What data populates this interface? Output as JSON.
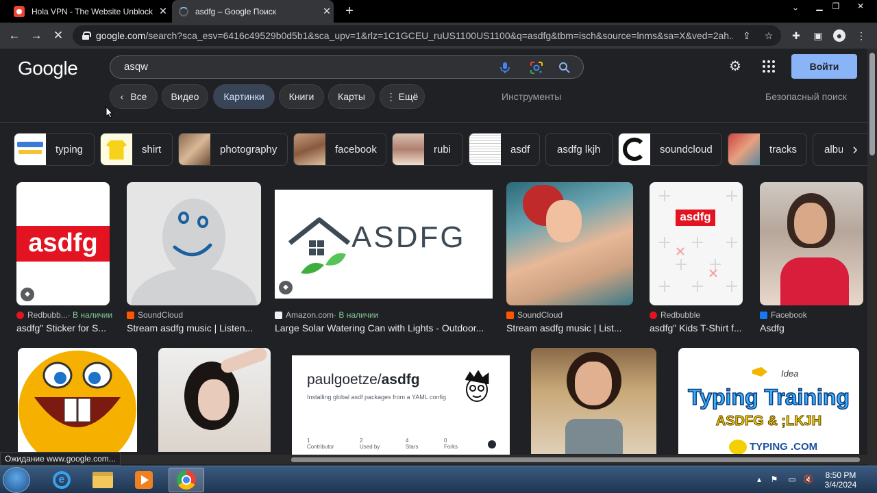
{
  "browser": {
    "tabs": [
      {
        "title": "Hola VPN - The Website Unblock",
        "close": "✕"
      },
      {
        "title": "asdfg – Google Поиск",
        "close": "✕"
      }
    ],
    "new_tab": "+",
    "url_host": "google.com",
    "url_rest": "/search?sca_esv=6416c49529b0d5b1&sca_upv=1&rlz=1C1GCEU_ruUS1100US1100&q=asdfg&tbm=isch&source=lnms&sa=X&ved=2ah..."
  },
  "google": {
    "logo": "Google",
    "search_value": "asqw",
    "signin": "Войти",
    "filters": [
      "Все",
      "Видео",
      "Картинки",
      "Книги",
      "Карты",
      "Ещё"
    ],
    "tools": "Инструменты",
    "safesearch": "Безопасный поиск"
  },
  "chips": [
    "typing",
    "shirt",
    "photography",
    "facebook",
    "rubi",
    "asdf",
    "asdfg lkjh",
    "soundcloud",
    "tracks",
    "albu"
  ],
  "results_row1": [
    {
      "source": "Redbubb...",
      "avail": " · В наличии",
      "title": "asdfg\" Sticker for S...",
      "fav_color": "#e41321"
    },
    {
      "source": "SoundCloud",
      "avail": "",
      "title": "Stream asdfg music | Listen...",
      "fav_color": "#ff5500"
    },
    {
      "source": "Amazon.com",
      "avail": " · В наличии",
      "title": "Large Solar Watering Can with Lights - Outdoor...",
      "fav_color": "#f0f0f0"
    },
    {
      "source": "SoundCloud",
      "avail": "",
      "title": "Stream asdfg music | List...",
      "fav_color": "#ff5500"
    },
    {
      "source": "Redbubble",
      "avail": "",
      "title": "asdfg\" Kids T-Shirt f...",
      "fav_color": "#e41321"
    },
    {
      "source": "Facebook",
      "avail": "",
      "title": "Asdfg",
      "fav_color": "#1877f2"
    }
  ],
  "image_text": {
    "asdfg_sticker": "asdfg",
    "asdfg_house": "ASDFG",
    "asdfg_kids": "asdfg",
    "github_user": "paulgoetze/",
    "github_repo": "asdfg",
    "github_desc": "Installing global asdf packages from a YAML config",
    "github_stats": [
      "1",
      "2",
      "4",
      "0"
    ],
    "github_stat_labels": [
      "Contributor",
      "Used by",
      "Stars",
      "Forks"
    ],
    "typing_title": "Typing Training",
    "typing_sub": "ASDFG & ;LKJH",
    "typing_brand": "TYPING .COM",
    "typing_idea": "Idea"
  },
  "status": "Ожидание www.google.com...",
  "clock": {
    "time": "8:50 PM",
    "date": "3/4/2024"
  }
}
